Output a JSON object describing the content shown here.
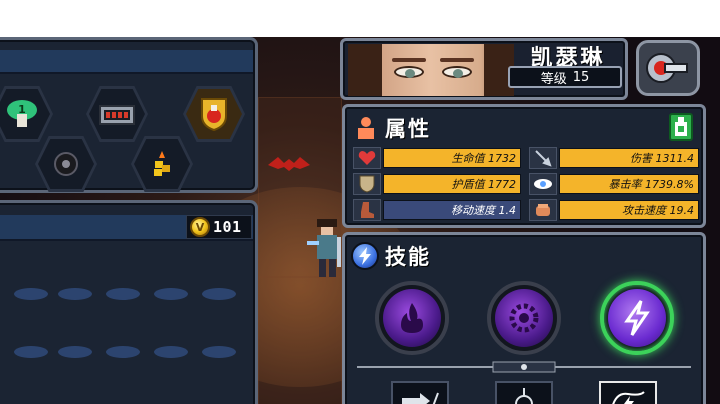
{
  "character": {
    "name": "凯瑟琳",
    "level_label": "等级",
    "level_value": "15"
  },
  "attributes": {
    "title": "属性",
    "stats": [
      {
        "key": "hp",
        "label": "生命值",
        "value": "1732",
        "fill": 1.0,
        "icon": "heart-icon",
        "color": "#e03a3a"
      },
      {
        "key": "damage",
        "label": "伤害",
        "value": "1311.4",
        "fill": 1.0,
        "icon": "sword-icon",
        "color": "#c9d2de"
      },
      {
        "key": "shield",
        "label": "护盾值",
        "value": "1772",
        "fill": 1.0,
        "icon": "shield-icon",
        "color": "#c8b48a"
      },
      {
        "key": "crit",
        "label": "暴击率",
        "value": "1739.8%",
        "fill": 1.0,
        "icon": "eye-icon",
        "color": "#5aa0ff"
      },
      {
        "key": "move",
        "label": "移动速度",
        "value": "1.4",
        "fill": 0.0,
        "icon": "boot-icon",
        "color": "#b85a3a"
      },
      {
        "key": "atkspd",
        "label": "攻击速度",
        "value": "19.4",
        "fill": 1.0,
        "icon": "fist-icon",
        "color": "#e08a5a"
      }
    ]
  },
  "skills": {
    "title": "技能",
    "orbs": [
      {
        "icon": "purple-flame-icon",
        "selected": false
      },
      {
        "icon": "purple-gear-icon",
        "selected": false
      },
      {
        "icon": "lightning-icon",
        "selected": true
      }
    ],
    "sub_skills": [
      "dash-icon",
      "grapple-icon",
      "bolt-scroll-icon"
    ]
  },
  "inventory": {
    "items": [
      "green-mushroom-icon",
      "ammo-case-icon",
      "potion-shield-icon",
      "black-orb-icon",
      "gold-nugget-icon"
    ]
  },
  "currency": {
    "coin_symbol": "V",
    "amount": "101"
  },
  "colors": {
    "panel_bg": "#1b2433",
    "panel_border": "#7c8698",
    "stat_fill": "#f4b42a",
    "stat_empty": "#3a4a7a",
    "selected_glow": "#3cd25a"
  }
}
